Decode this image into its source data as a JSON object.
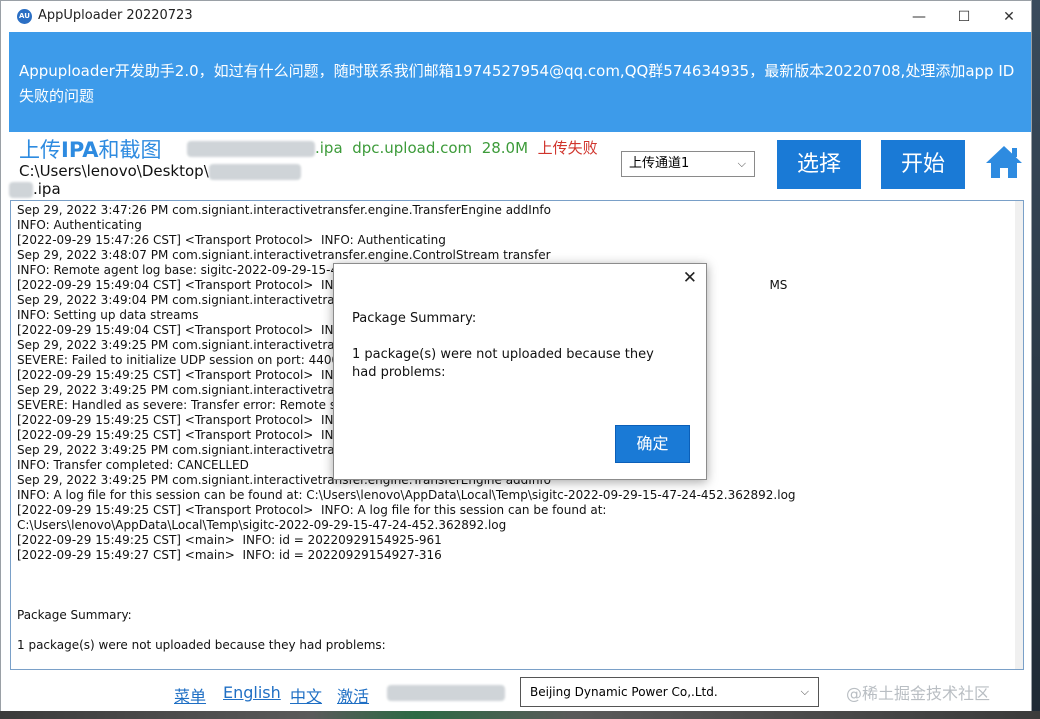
{
  "window": {
    "app_icon_text": "AU",
    "title": "AppUploader 20220723",
    "minimize": "—",
    "maximize": "☐",
    "close": "✕"
  },
  "banner": {
    "text": "Appuploader开发助手2.0，如过有什么问题，随时联系我们邮箱1974527954@qq.com,QQ群574634935，最新版本20220708,处理添加app ID失败的问题"
  },
  "upload": {
    "title_prefix": "上传",
    "title_bold": "IPA",
    "title_suffix": "和截图",
    "file_ext": ".ipa",
    "server": "dpc.upload.com",
    "size": "28.0M",
    "status": "上传失败",
    "path_prefix": "C:\\Users\\lenovo\\Desktop\\",
    "path_ext": ".ipa",
    "channel": "上传通道1",
    "select_button": "选择",
    "start_button": "开始"
  },
  "log": {
    "lines": [
      "Sep 29, 2022 3:47:26 PM com.signiant.interactivetransfer.engine.TransferEngine addInfo",
      "INFO: Authenticating",
      "[2022-09-29 15:47:26 CST] <Transport Protocol>  INFO: Authenticating",
      "Sep 29, 2022 3:48:07 PM com.signiant.interactivetransfer.engine.ControlStream transfer",
      "INFO: Remote agent log base: sigitc-2022-09-29-15-47",
      "[2022-09-29 15:49:04 CST] <Transport Protocol>  INFO                                                                                                              MS",
      "Sep 29, 2022 3:49:04 PM com.signiant.interactivetransfe",
      "INFO: Setting up data streams",
      "[2022-09-29 15:49:04 CST] <Transport Protocol>  INFO",
      "Sep 29, 2022 3:49:25 PM com.signiant.interactivetransfe",
      "SEVERE: Failed to initialize UDP session on port: 44004",
      "[2022-09-29 15:49:25 CST] <Transport Protocol>  INFO",
      "Sep 29, 2022 3:49:25 PM com.signiant.interactivetransfe",
      "SEVERE: Handled as severe: Transfer error: Remote syst",
      "[2022-09-29 15:49:25 CST] <Transport Protocol>  INFO",
      "[2022-09-29 15:49:25 CST] <Transport Protocol>  INFO",
      "Sep 29, 2022 3:49:25 PM com.signiant.interactivetransfe",
      "INFO: Transfer completed: CANCELLED",
      "Sep 29, 2022 3:49:25 PM com.signiant.interactivetransfer.engine.TransferEngine addInfo",
      "INFO: A log file for this session can be found at: C:\\Users\\lenovo\\AppData\\Local\\Temp\\sigitc-2022-09-29-15-47-24-452.362892.log",
      "[2022-09-29 15:49:25 CST] <Transport Protocol>  INFO: A log file for this session can be found at:",
      "C:\\Users\\lenovo\\AppData\\Local\\Temp\\sigitc-2022-09-29-15-47-24-452.362892.log",
      "[2022-09-29 15:49:25 CST] <main>  INFO: id = 20220929154925-961",
      "[2022-09-29 15:49:27 CST] <main>  INFO: id = 20220929154927-316",
      "",
      "",
      "",
      "Package Summary:",
      "",
      "1 package(s) were not uploaded because they had problems:"
    ]
  },
  "footer": {
    "menu": "菜单",
    "english": "English",
    "chinese": "中文",
    "activate": "激活",
    "company": "Beijing Dynamic Power Co,.Ltd.",
    "watermark": "@稀土掘金技术社区"
  },
  "dialog": {
    "close": "✕",
    "title": "Package Summary:",
    "message": "1 package(s) were not uploaded because they had problems:",
    "ok_button": "确定"
  }
}
